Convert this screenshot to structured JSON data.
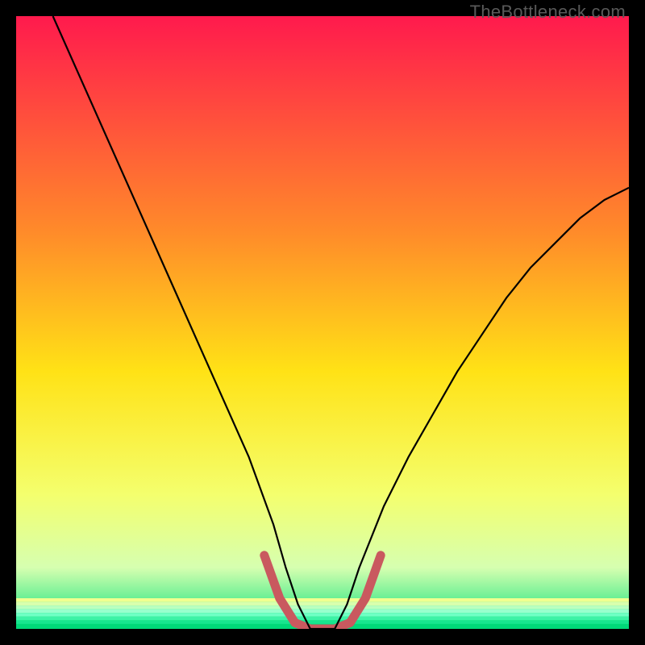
{
  "watermark": {
    "text": "TheBottleneck.com"
  },
  "chart_data": {
    "type": "line",
    "title": "",
    "xlabel": "",
    "ylabel": "",
    "xlim": [
      0,
      100
    ],
    "ylim": [
      0,
      100
    ],
    "curve": {
      "x": [
        6,
        10,
        14,
        18,
        22,
        26,
        30,
        34,
        38,
        42,
        44,
        46,
        48,
        50,
        52,
        54,
        56,
        60,
        64,
        68,
        72,
        76,
        80,
        84,
        88,
        92,
        96,
        100
      ],
      "y": [
        100,
        91,
        82,
        73,
        64,
        55,
        46,
        37,
        28,
        17,
        10,
        4,
        0,
        0,
        0,
        4,
        10,
        20,
        28,
        35,
        42,
        48,
        54,
        59,
        63,
        67,
        70,
        72
      ],
      "stroke": "#000000",
      "stroke_width": 2.2
    },
    "highlight": {
      "x": [
        40.5,
        43,
        45.5,
        48,
        50,
        52,
        54.5,
        57,
        59.5
      ],
      "y": [
        12,
        5,
        1,
        0,
        0,
        0,
        1,
        5,
        12
      ],
      "stroke": "#c9595f",
      "stroke_width": 11,
      "linecap": "round"
    },
    "gradient_stops": {
      "top": "#ff1a4d",
      "mid1": "#ff8a2a",
      "mid2": "#ffe216",
      "mid3": "#f4ff6d",
      "mid4": "#d6ffb0",
      "bot": "#00e07a"
    },
    "green_bands": [
      {
        "y": 95.0,
        "h": 0.5,
        "color": "#f0ff90"
      },
      {
        "y": 95.6,
        "h": 0.5,
        "color": "#d9ffad"
      },
      {
        "y": 96.2,
        "h": 0.5,
        "color": "#baffc0"
      },
      {
        "y": 96.8,
        "h": 0.5,
        "color": "#98ffcd"
      },
      {
        "y": 97.4,
        "h": 0.5,
        "color": "#6effc4"
      },
      {
        "y": 98.0,
        "h": 0.5,
        "color": "#3df2a6"
      },
      {
        "y": 98.6,
        "h": 0.5,
        "color": "#17e58e"
      },
      {
        "y": 99.2,
        "h": 0.8,
        "color": "#00d878"
      }
    ]
  }
}
